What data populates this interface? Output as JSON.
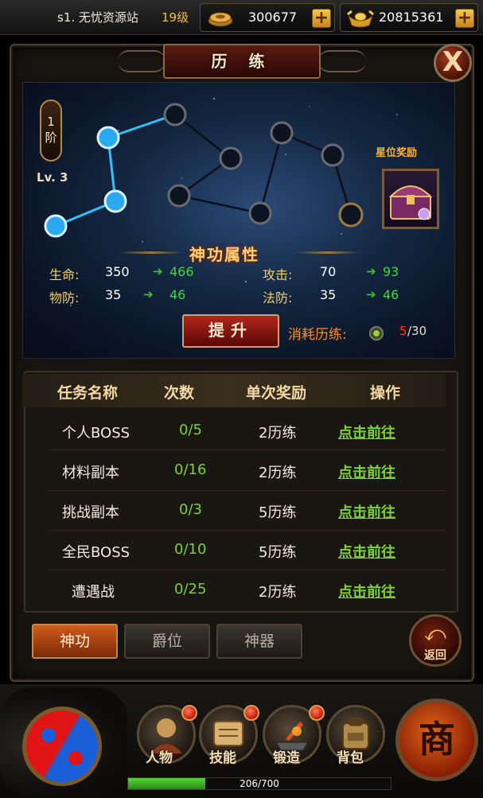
{
  "topbar": {
    "server": "s1. 无忧资源站",
    "level": "19级",
    "gold": "300677",
    "ingot": "20815361",
    "plus": "+"
  },
  "panel": {
    "title": "历 练",
    "close": "X",
    "rank": "1\n阶",
    "rank_num": "1",
    "rank_char": "阶",
    "lv": "Lv. 3",
    "reward_title": "星位奖励",
    "attr_banner": "神功属性"
  },
  "stats": [
    {
      "key": "生命:",
      "cur": "350",
      "next": "466"
    },
    {
      "key": "攻击:",
      "cur": "70",
      "next": "93"
    },
    {
      "key": "物防:",
      "cur": "35",
      "next": "46"
    },
    {
      "key": "法防:",
      "cur": "35",
      "next": "46"
    }
  ],
  "upgrade": {
    "button": "提升",
    "cost_label": "消耗历练:",
    "cost_current": "5",
    "cost_max": "/30"
  },
  "table": {
    "headers": [
      "任务名称",
      "次数",
      "单次奖励",
      "操作"
    ],
    "rows": [
      {
        "name": "个人BOSS",
        "count": "0/5",
        "reward": "2历练",
        "action": "点击前往"
      },
      {
        "name": "材料副本",
        "count": "0/16",
        "reward": "2历练",
        "action": "点击前往"
      },
      {
        "name": "挑战副本",
        "count": "0/3",
        "reward": "5历练",
        "action": "点击前往"
      },
      {
        "name": "全民BOSS",
        "count": "0/10",
        "reward": "5历练",
        "action": "点击前往"
      },
      {
        "name": "遭遇战",
        "count": "0/25",
        "reward": "2历练",
        "action": "点击前往"
      }
    ]
  },
  "tabs": [
    {
      "label": "神功",
      "active": true
    },
    {
      "label": "爵位",
      "active": false
    },
    {
      "label": "神器",
      "active": false
    }
  ],
  "back_label": "返回",
  "menu": [
    {
      "label": "人物",
      "icon": "character-icon"
    },
    {
      "label": "技能",
      "icon": "skill-scroll-icon"
    },
    {
      "label": "锻造",
      "icon": "forge-icon"
    },
    {
      "label": "背包",
      "icon": "backpack-icon"
    }
  ],
  "shop_label": "商",
  "exp": {
    "text": "206/700",
    "progress": 0.294
  },
  "colors": {
    "accent_gold": "#f0c040",
    "green": "#7bd234",
    "red_button": "#b0261c",
    "sky": "#142842"
  }
}
